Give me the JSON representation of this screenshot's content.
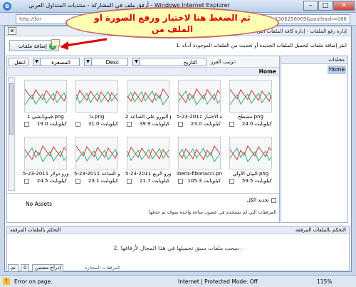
{
  "window": {
    "title": "أرفق ملف في المشاركة - منتديات المتداول العربي - Windows Internet Explorer",
    "min": "–",
    "max": "□",
    "close": "✕"
  },
  "address": {
    "left": "http://for",
    "right": "time=1306256069&posthash=088"
  },
  "header": {
    "title": "إدارة رفع الملفات - إدارة كافة الملفات التي قمت بتحميلها",
    "close_icon": "✕"
  },
  "instruction": "1. انقر إضافة ملفات لتحميل الملفات الجديدة أو تحديث من الملفات الموجودة أدناه",
  "add_button": {
    "label": "إضافة ملفات",
    "icon": "plus-icon"
  },
  "callout": {
    "text": "ثم الضغط هنا لاختيار ورفع الصورة او الملف من"
  },
  "sidebar": {
    "title": "مجلدات",
    "home": "Home"
  },
  "toolbar": {
    "sort_label": "ترتيب الفرز:",
    "sort_field": "التاريخ",
    "order": "Desc",
    "view": "المصغرة",
    "apply": "انتقل"
  },
  "path": "Home",
  "tiles": [
    {
      "caption": "مسطح.png",
      "size": "24.0 كيلوبايت"
    },
    {
      "caption": "5-23-2011 اة الاختبار",
      "size": "23.0 كيلوبايت"
    },
    {
      "caption": "اليورو على الساعة 2.png",
      "size": "39.9 كيلوبايت"
    },
    {
      "caption": "ذا.png",
      "size": "31.0 كيلوبايت"
    },
    {
      "caption": "فيبونانشي 1.png",
      "size": "19.0 كيلوبايت"
    },
    {
      "caption": "البيان الأولي.png",
      "size": "59.5 كيلوبايت"
    },
    {
      "caption": "ibens-fibonacci.png",
      "size": "105.3 كيلوبايت"
    },
    {
      "caption": "5-23-2011 اليورو الربع",
      "size": "21.7 كيلوبايت"
    },
    {
      "caption": "5-23-2011 باليورو الساعة",
      "size": "23.1 كيلوبايت"
    },
    {
      "caption": "5-23-2011 باليورو دولار",
      "size": "24.5 كيلوبايت"
    }
  ],
  "no_assets": "No Assets",
  "select_all": "تحديد الكل",
  "note": "المرفقات التي لم تستخدم في عصون ساعة واحدة سوف تم حذفها",
  "attach": {
    "title": "التحكم بالملفات المرفقة",
    "left": "التحكم بالملفات المرفقة",
    "drop": "2. سحب ملفات سبق تحميلها في هذا المجال لأرفاقها ."
  },
  "bottom": {
    "ok": "تم",
    "insert": "إدراج مضمن",
    "count": "0",
    "label": "المرفقات المختارة"
  },
  "status": {
    "error": "Error on page.",
    "zone": "Internet | Protected Mode: Off",
    "zoom": "115%"
  }
}
